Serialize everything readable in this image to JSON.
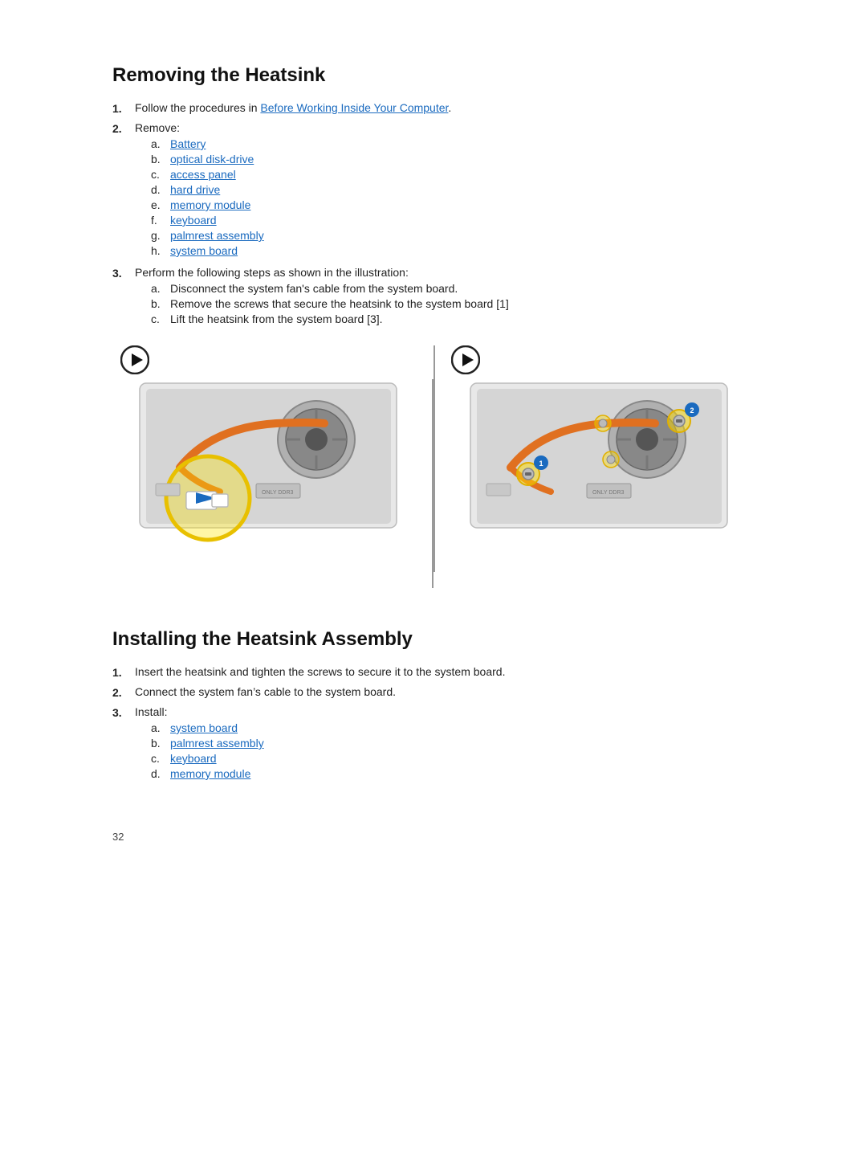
{
  "removing_section": {
    "title": "Removing the Heatsink",
    "steps": [
      {
        "num": "1.",
        "text_before": "Follow the procedures in ",
        "link": "Before Working Inside Your Computer",
        "text_after": "."
      },
      {
        "num": "2.",
        "text": "Remove:",
        "sub_items": [
          {
            "letter": "a.",
            "link": "Battery"
          },
          {
            "letter": "b.",
            "link": "optical disk-drive"
          },
          {
            "letter": "c.",
            "link": "access panel"
          },
          {
            "letter": "d.",
            "link": "hard drive"
          },
          {
            "letter": "e.",
            "link": "memory module"
          },
          {
            "letter": "f.",
            "link": "keyboard"
          },
          {
            "letter": "g.",
            "link": "palmrest assembly"
          },
          {
            "letter": "h.",
            "link": "system board"
          }
        ]
      },
      {
        "num": "3.",
        "text": "Perform the following steps as shown in the illustration:",
        "sub_items": [
          {
            "letter": "a.",
            "text": "Disconnect the system fan’s cable from the system board."
          },
          {
            "letter": "b.",
            "text": "Remove the screws that secure the heatsink to the system board [1]"
          },
          {
            "letter": "c.",
            "text": "Lift the heatsink from the system board [3]."
          }
        ]
      }
    ]
  },
  "installing_section": {
    "title": "Installing the Heatsink Assembly",
    "steps": [
      {
        "num": "1.",
        "text": "Insert the heatsink and tighten the screws to secure it to the system board."
      },
      {
        "num": "2.",
        "text": "Connect the system fan’s cable to the system board."
      },
      {
        "num": "3.",
        "text": "Install:",
        "sub_items": [
          {
            "letter": "a.",
            "link": "system board"
          },
          {
            "letter": "b.",
            "link": "palmrest assembly"
          },
          {
            "letter": "c.",
            "link": "keyboard"
          },
          {
            "letter": "d.",
            "link": "memory module"
          }
        ]
      }
    ]
  },
  "page_number": "32"
}
